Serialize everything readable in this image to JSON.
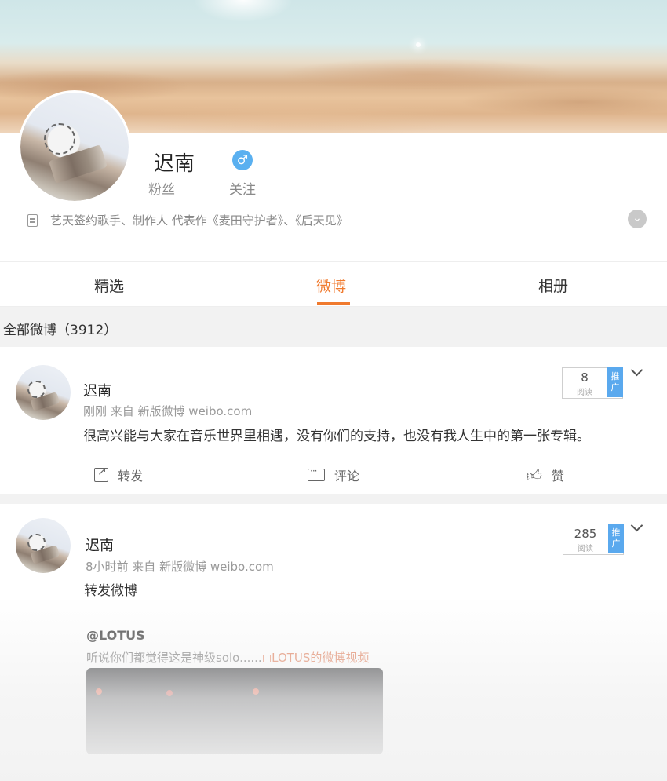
{
  "profile": {
    "name": "迟南",
    "fans_label": "粉丝",
    "follow_label": "关注",
    "bio": "艺天签约歌手、制作人   代表作《麦田守护者》、《后天见》",
    "gender_symbol": "♂",
    "gender_color": "#5ab0f0"
  },
  "tabs": [
    {
      "label": "精选",
      "active": false
    },
    {
      "label": "微博",
      "active": true
    },
    {
      "label": "相册",
      "active": false
    }
  ],
  "feed": {
    "count_label": "全部微博（3912）"
  },
  "posts": [
    {
      "author": "迟南",
      "meta": "刚刚  来自 新版微博 weibo.com",
      "text": "很高兴能与大家在音乐世界里相遇，没有你们的支持，也没有我人生中的第一张专辑。",
      "reads": "8",
      "reads_label": "阅读",
      "promote_label": "推广",
      "actions": {
        "forward": "转发",
        "comment": "评论",
        "like": "赞"
      }
    },
    {
      "author": "迟南",
      "meta": "8小时前  来自 新版微博 weibo.com",
      "text": "转发微博",
      "reads": "285",
      "reads_label": "阅读",
      "promote_label": "推广",
      "repost": {
        "user": "@LOTUS",
        "text": "听说你们都觉得这是神级solo......",
        "link": "LOTUS的微博视频"
      }
    }
  ],
  "colors": {
    "accent": "#f07a2e",
    "promote": "#5aa9ee"
  }
}
